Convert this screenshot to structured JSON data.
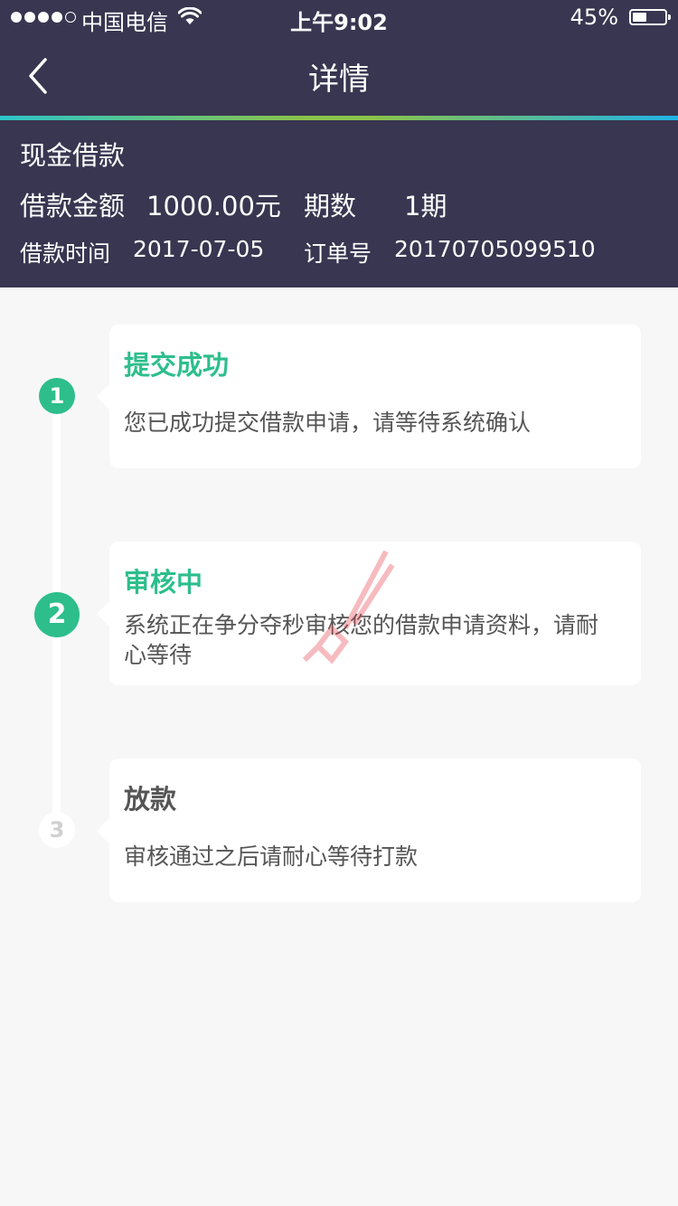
{
  "status_bar": {
    "carrier": "中国电信",
    "time": "上午9:02",
    "battery": "45%",
    "battery_level": 0.45
  },
  "nav": {
    "title": "详情",
    "back_icon": "chevron-left-icon"
  },
  "loan": {
    "type": "现金借款",
    "amount_label": "借款金额",
    "amount": "1000.00元",
    "period_label": "期数",
    "period": "1期",
    "time_label": "借款时间",
    "time": "2017-07-05",
    "order_label": "订单号",
    "order_no": "20170705099510"
  },
  "steps": [
    {
      "number": "1",
      "title": "提交成功",
      "desc": "您已成功提交借款申请，请等待系统确认",
      "state": "done"
    },
    {
      "number": "2",
      "title": "审核中",
      "desc": "系统正在争分夺秒审核您的借款申请资料，请耐心等待",
      "state": "current"
    },
    {
      "number": "3",
      "title": "放款",
      "desc": "审核通过之后请耐心等待打款",
      "state": "pending"
    }
  ],
  "colors": {
    "header_bg": "#383650",
    "accent_green": "#2dbe8c",
    "page_bg": "#f7f7f7"
  }
}
